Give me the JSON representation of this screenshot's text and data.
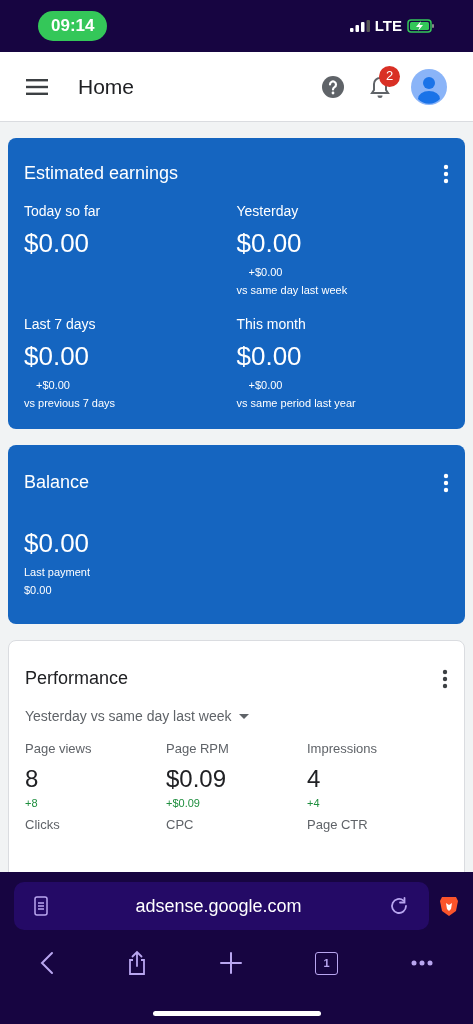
{
  "status_bar": {
    "time": "09:14",
    "network": "LTE"
  },
  "header": {
    "title": "Home",
    "notification_count": "2"
  },
  "earnings": {
    "title": "Estimated earnings",
    "items": [
      {
        "label": "Today so far",
        "amount": "$0.00"
      },
      {
        "label": "Yesterday",
        "amount": "$0.00",
        "change": "+$0.00",
        "comparison": "vs same day last week"
      },
      {
        "label": "Last 7 days",
        "amount": "$0.00",
        "change": "+$0.00",
        "comparison": "vs previous 7 days"
      },
      {
        "label": "This month",
        "amount": "$0.00",
        "change": "+$0.00",
        "comparison": "vs same period last year"
      }
    ]
  },
  "balance": {
    "title": "Balance",
    "amount": "$0.00",
    "last_payment_label": "Last payment",
    "last_payment": "$0.00"
  },
  "performance": {
    "title": "Performance",
    "range": "Yesterday vs same day last week",
    "metrics": [
      {
        "label": "Page views",
        "value": "8",
        "change": "+8"
      },
      {
        "label": "Page RPM",
        "value": "$0.09",
        "change": "+$0.09"
      },
      {
        "label": "Impressions",
        "value": "4",
        "change": "+4"
      },
      {
        "label": "Clicks"
      },
      {
        "label": "CPC"
      },
      {
        "label": "Page CTR"
      }
    ]
  },
  "browser": {
    "url": "adsense.google.com",
    "tab_count": "1"
  }
}
